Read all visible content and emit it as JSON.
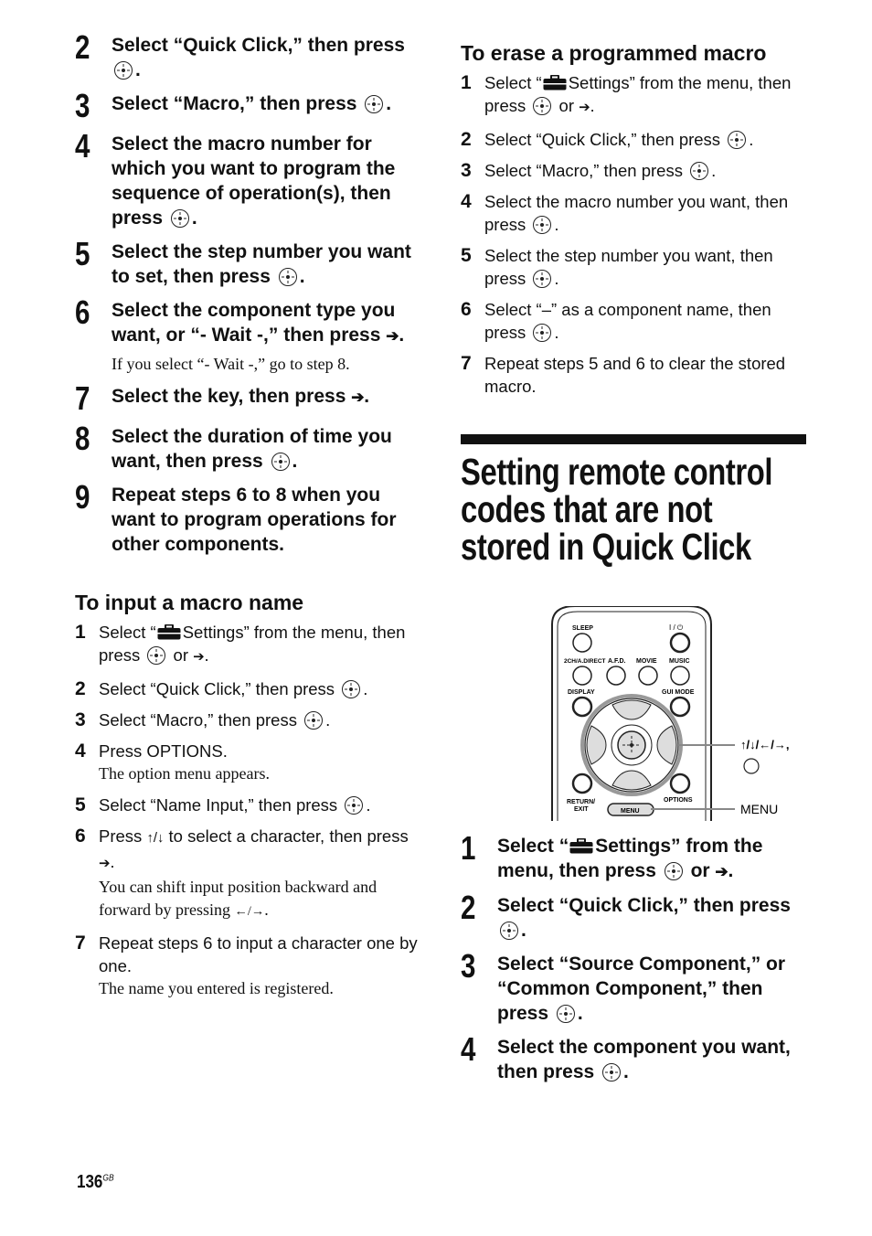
{
  "left": {
    "big_steps": [
      {
        "num": "2",
        "text": "Select “Quick Click,” then press",
        "suffix": "."
      },
      {
        "num": "3",
        "text": "Select “Macro,” then press",
        "suffix": "."
      },
      {
        "num": "4",
        "text": "Select the macro number for which you want to program the sequence of operation(s), then press",
        "suffix": "."
      },
      {
        "num": "5",
        "text": "Select the step number you want to set, then press",
        "suffix": "."
      },
      {
        "num": "6",
        "text": "Select the component type you want, or “- Wait -,” then press",
        "suffix": ".",
        "note": "If you select “- Wait -,” go to step 8."
      },
      {
        "num": "7",
        "text": "Select the key, then press",
        "suffix": "."
      },
      {
        "num": "8",
        "text": "Select the duration of time you want, then press",
        "suffix": "."
      },
      {
        "num": "9",
        "text": "Repeat steps 6 to 8 when you want to program operations for other components."
      }
    ],
    "macro_name": {
      "heading": "To input a macro name",
      "steps": [
        {
          "num": "1",
          "pre": "Select “",
          "text": "Settings” from the menu, then press",
          "or": "or",
          "suffix": "."
        },
        {
          "num": "2",
          "text": "Select “Quick Click,” then press",
          "suffix": "."
        },
        {
          "num": "3",
          "text": "Select “Macro,” then press",
          "suffix": "."
        },
        {
          "num": "4",
          "text": "Press OPTIONS.",
          "note": "The option menu appears."
        },
        {
          "num": "5",
          "text": "Select “Name Input,” then press",
          "suffix": "."
        },
        {
          "num": "6",
          "text_a": "Press",
          "arrows": "↑/↓",
          "text_b": "to select a character, then press",
          "suffix": ".",
          "note": "You can shift input position backward and forward by pressing",
          "note_arrows": "←/→",
          "note_suffix": "."
        },
        {
          "num": "7",
          "text": "Repeat steps 6 to input a character one by one.",
          "note": "The name you entered is registered."
        }
      ]
    }
  },
  "right": {
    "erase": {
      "heading": "To erase a programmed macro",
      "steps": [
        {
          "num": "1",
          "pre": "Select “",
          "text": "Settings” from the menu, then press",
          "or": "or",
          "suffix": "."
        },
        {
          "num": "2",
          "text": "Select “Quick Click,” then press",
          "suffix": "."
        },
        {
          "num": "3",
          "text": "Select “Macro,” then press",
          "suffix": "."
        },
        {
          "num": "4",
          "text": "Select the macro number you want, then press",
          "suffix": "."
        },
        {
          "num": "5",
          "text": "Select the step number you want, then press",
          "suffix": "."
        },
        {
          "num": "6",
          "text": "Select “–” as a component name, then press",
          "suffix": "."
        },
        {
          "num": "7",
          "text": "Repeat steps 5 and 6 to clear the stored macro."
        }
      ]
    },
    "section_title": "Setting remote control codes that are not stored in Quick Click",
    "remote": {
      "buttons": {
        "sleep": "SLEEP",
        "power": "I / ⏻",
        "two_ch": "2CH/A.DIRECT",
        "afd": "A.F.D.",
        "movie": "MOVIE",
        "music": "MUSIC",
        "display": "DISPLAY",
        "gui_mode": "GUI MODE",
        "return": "RETURN/",
        "exit": "EXIT",
        "options": "OPTIONS",
        "menu": "MENU"
      },
      "callout_arrows": "↑/↓/←/→,",
      "callout_menu": "MENU"
    },
    "big_steps": [
      {
        "num": "1",
        "pre": "Select “",
        "text": "Settings” from the menu, then press",
        "or": "or",
        "suffix": "."
      },
      {
        "num": "2",
        "text": "Select “Quick Click,” then press",
        "suffix": "."
      },
      {
        "num": "3",
        "text": "Select “Source Component,” or “Common Component,” then press",
        "suffix": "."
      },
      {
        "num": "4",
        "text": "Select the component you want, then press",
        "suffix": "."
      }
    ]
  },
  "footer": {
    "page": "136",
    "region": "GB"
  }
}
